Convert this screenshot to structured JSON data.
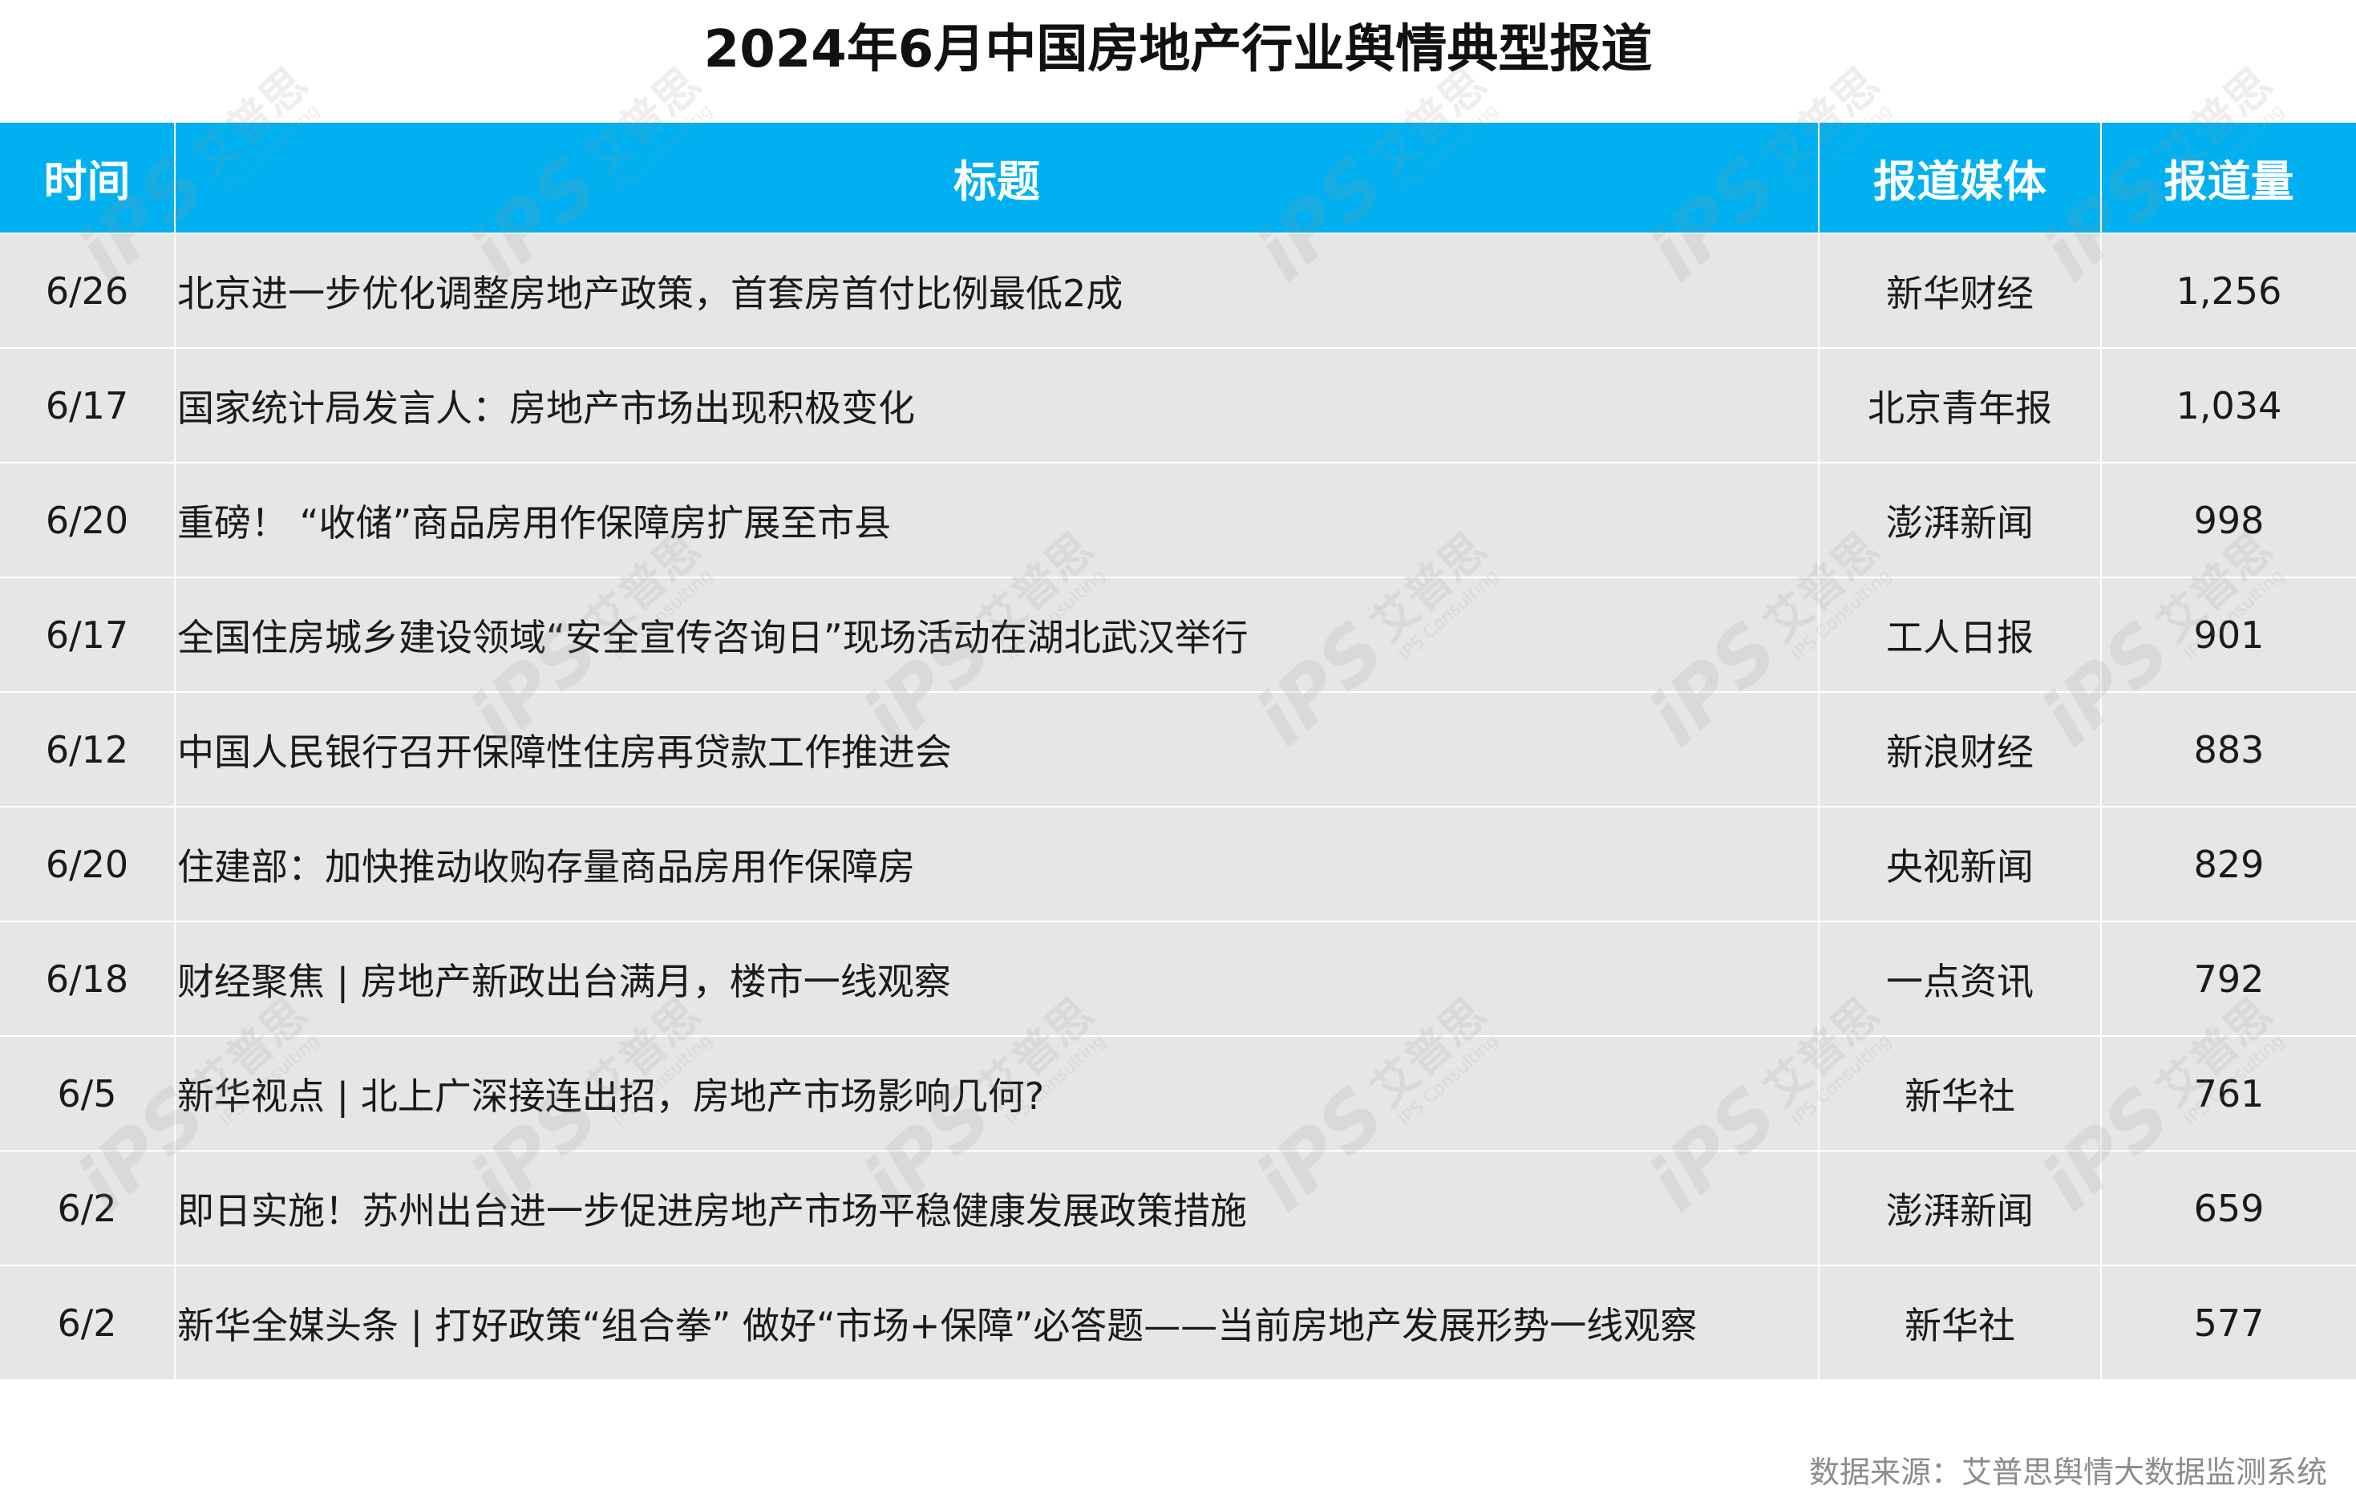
{
  "title": "2024年6月中国房地产行业舆情典型报道",
  "table": {
    "headers": {
      "time": "时间",
      "title": "标题",
      "media": "报道媒体",
      "count": "报道量"
    },
    "rows": [
      {
        "time": "6/26",
        "title": "北京进一步优化调整房地产政策，首套房首付比例最低2成",
        "media": "新华财经",
        "count": "1,256"
      },
      {
        "time": "6/17",
        "title": "国家统计局发言人：房地产市场出现积极变化",
        "media": "北京青年报",
        "count": "1,034"
      },
      {
        "time": "6/20",
        "title": "重磅！ “收储”商品房用作保障房扩展至市县",
        "media": "澎湃新闻",
        "count": "998"
      },
      {
        "time": "6/17",
        "title": "全国住房城乡建设领域“安全宣传咨询日”现场活动在湖北武汉举行",
        "media": "工人日报",
        "count": "901"
      },
      {
        "time": "6/12",
        "title": "中国人民银行召开保障性住房再贷款工作推进会",
        "media": "新浪财经",
        "count": "883"
      },
      {
        "time": "6/20",
        "title": "住建部：加快推动收购存量商品房用作保障房",
        "media": "央视新闻",
        "count": "829"
      },
      {
        "time": "6/18",
        "title": "财经聚焦 | 房地产新政出台满月，楼市一线观察",
        "media": "一点资讯",
        "count": "792"
      },
      {
        "time": "6/5",
        "title": "新华视点 | 北上广深接连出招，房地产市场影响几何?",
        "media": "新华社",
        "count": "761"
      },
      {
        "time": "6/2",
        "title": "即日实施！苏州出台进一步促进房地产市场平稳健康发展政策措施",
        "media": "澎湃新闻",
        "count": "659"
      },
      {
        "time": "6/2",
        "title": "新华全媒头条 | 打好政策“组合拳” 做好“市场+保障”必答题——当前房地产发展形势一线观察",
        "media": "新华社",
        "count": "577"
      }
    ]
  },
  "source": "数据来源：艾普思舆情大数据监测系统",
  "watermark": {
    "mark": "iPS",
    "brand_cn": "艾普思",
    "brand_en": "IPS Consulting"
  }
}
